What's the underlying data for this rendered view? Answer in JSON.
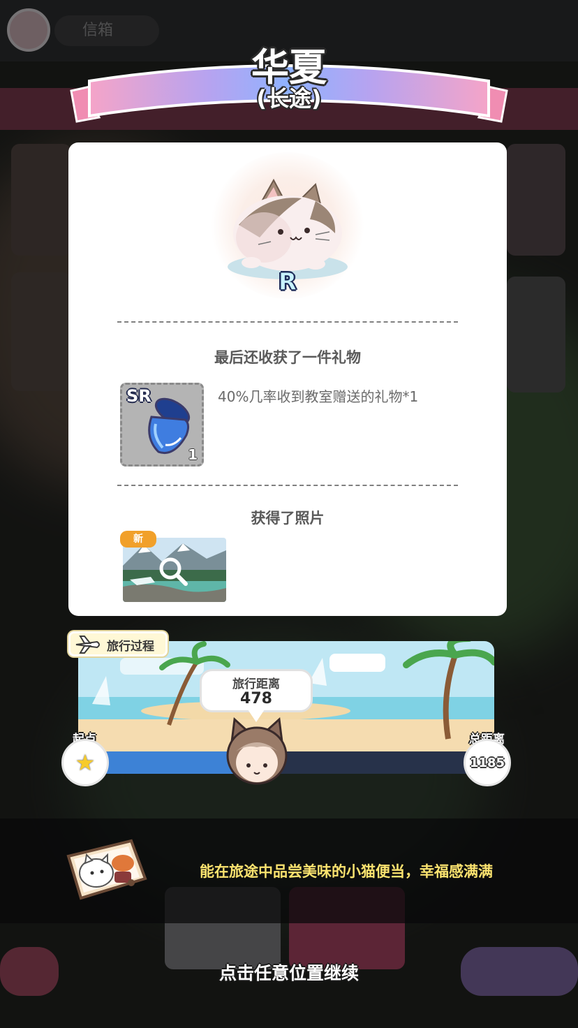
{
  "background": {
    "letter_label": "信箱"
  },
  "header": {
    "title": "华夏",
    "subtitle": "(长途)"
  },
  "result": {
    "rarity": "R",
    "gift_section_title": "最后还收获了一件礼物",
    "gift": {
      "rarity": "SR",
      "count": "1",
      "description": "40%几率收到教室赠送的礼物*1"
    },
    "photo_section_title": "获得了照片",
    "photo_badge": "新"
  },
  "travel": {
    "tag_label": "旅行过程",
    "distance_label": "旅行距离",
    "distance_value": "478",
    "start_label": "起点",
    "total_label": "总距离",
    "total_value": "1185",
    "progress_fraction": 0.403
  },
  "caption": {
    "text": "能在旅途中品尝美味的小猫便当，幸福感满满"
  },
  "footer": {
    "continue_hint": "点击任意位置继续"
  },
  "colors": {
    "progress_fill": "#3d82d6",
    "caption_text": "#fbe36f",
    "new_badge": "#f1a02a"
  }
}
